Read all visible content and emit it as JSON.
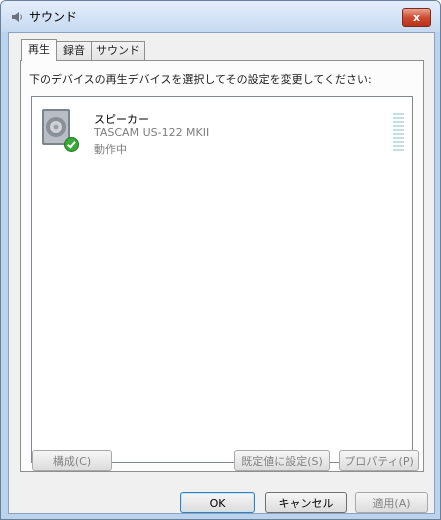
{
  "window": {
    "title": "サウンド",
    "close_label": "x"
  },
  "tabs": [
    {
      "label": "再生",
      "active": true
    },
    {
      "label": "録音",
      "active": false
    },
    {
      "label": "サウンド",
      "active": false
    }
  ],
  "playback": {
    "instruction": "下のデバイスの再生デバイスを選択してその設定を変更してください:",
    "devices": [
      {
        "name": "スピーカー",
        "model": "TASCAM US-122 MKII",
        "status": "動作中",
        "icon": "speaker-icon",
        "badge": "default-device-check-icon"
      }
    ],
    "buttons": {
      "configure": "構成(C)",
      "set_default": "既定値に設定(S)",
      "properties": "プロパティ(P)"
    }
  },
  "footer": {
    "ok": "OK",
    "cancel": "キャンセル",
    "apply": "適用(A)"
  },
  "colors": {
    "titlebar": "#c6d9f1",
    "close": "#c8452e",
    "check": "#3aa83a",
    "meter": "#c8dbe9"
  }
}
